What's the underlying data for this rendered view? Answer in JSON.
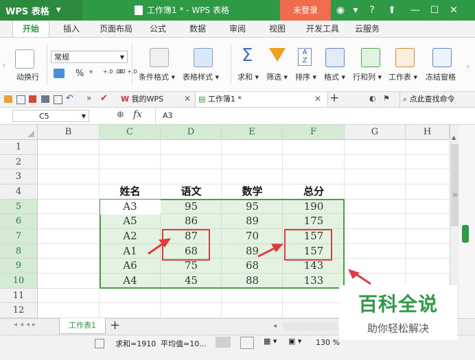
{
  "titlebar": {
    "app_label": "WPS 表格",
    "doc_title": "工作簿1 * - WPS 表格",
    "login_label": "未登录",
    "help_label": "?"
  },
  "menu_tabs": [
    "开始",
    "插入",
    "页面布局",
    "公式",
    "数据",
    "审阅",
    "视图",
    "开发工具",
    "云服务"
  ],
  "ribbon": {
    "wrap_label": "动换行",
    "number_format": "常规",
    "percent": "%",
    "comma": "⁹",
    "dec_inc": "+.0 .00",
    "dec_dec": ".00 +.0",
    "cond_format": "条件格式",
    "table_style": "表格样式",
    "sum": "求和",
    "filter": "筛选",
    "sort": "排序",
    "format": "格式",
    "rowcol": "行和列",
    "worksheet": "工作表",
    "freeze": "冻结窗格"
  },
  "doc_tabs": {
    "mywps": "我的WPS",
    "workbook": "工作簿1 *",
    "search": "点此查找命令"
  },
  "formula": {
    "name_box": "C5",
    "fx": "fx",
    "value": "A3"
  },
  "columns": [
    "B",
    "C",
    "D",
    "E",
    "F",
    "G",
    "H"
  ],
  "rows": [
    "1",
    "2",
    "3",
    "4",
    "5",
    "6",
    "7",
    "8",
    "9",
    "10",
    "11",
    "12"
  ],
  "table": {
    "headers": [
      "姓名",
      "语文",
      "数学",
      "总分"
    ],
    "data": [
      [
        "A3",
        "95",
        "95",
        "190"
      ],
      [
        "A5",
        "86",
        "89",
        "175"
      ],
      [
        "A2",
        "87",
        "70",
        "157"
      ],
      [
        "A1",
        "68",
        "89",
        "157"
      ],
      [
        "A6",
        "75",
        "68",
        "143"
      ],
      [
        "A4",
        "45",
        "88",
        "133"
      ]
    ]
  },
  "sheet": {
    "tab_label": "工作表1",
    "add": "+"
  },
  "status": {
    "sum_text": "求和=1910",
    "avg_text": "平均值=10...",
    "zoom": "130 %"
  },
  "watermark": {
    "line1": "百科全说",
    "line2": "助你轻松解决"
  },
  "colors": {
    "wps_green": "#2f9a45",
    "login_orange": "#ef6d4c",
    "highlight_red": "#e03a3a"
  }
}
